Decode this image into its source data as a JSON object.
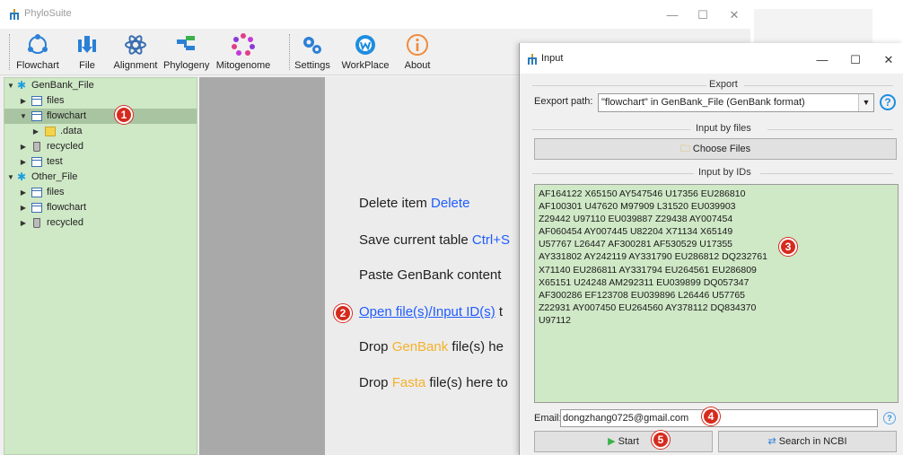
{
  "main_window": {
    "title": "PhyloSuite",
    "controls": {
      "minimize": "—",
      "maximize": "☐",
      "close": "✕"
    }
  },
  "toolbar": {
    "items": [
      {
        "label": "Flowchart",
        "icon": "flowchart-icon"
      },
      {
        "label": "File",
        "icon": "file-upload-icon"
      },
      {
        "label": "Alignment",
        "icon": "alignment-icon"
      },
      {
        "label": "Phylogeny",
        "icon": "phylogeny-icon"
      },
      {
        "label": "Mitogenome",
        "icon": "mitogenome-icon"
      },
      {
        "label": "Settings",
        "icon": "settings-icon"
      },
      {
        "label": "WorkPlace",
        "icon": "workplace-icon"
      },
      {
        "label": "About",
        "icon": "about-icon"
      }
    ]
  },
  "tree": {
    "items": [
      {
        "label": "GenBank_File",
        "level": 0,
        "expanded": true,
        "icon": "root-icon"
      },
      {
        "label": "files",
        "level": 1,
        "expanded": false,
        "icon": "table-icon"
      },
      {
        "label": "flowchart",
        "level": 1,
        "expanded": true,
        "icon": "table-icon",
        "selected": true
      },
      {
        "label": ".data",
        "level": 2,
        "expanded": false,
        "icon": "folder-icon"
      },
      {
        "label": "recycled",
        "level": 1,
        "expanded": false,
        "icon": "trash-icon"
      },
      {
        "label": "test",
        "level": 1,
        "expanded": false,
        "icon": "table-icon"
      },
      {
        "label": "Other_File",
        "level": 0,
        "expanded": true,
        "icon": "root-icon"
      },
      {
        "label": "files",
        "level": 1,
        "expanded": false,
        "icon": "table-icon"
      },
      {
        "label": "flowchart",
        "level": 1,
        "expanded": false,
        "icon": "table-icon"
      },
      {
        "label": "recycled",
        "level": 1,
        "expanded": false,
        "icon": "trash-icon"
      }
    ]
  },
  "center_hints": {
    "delete_prefix": "Delete item ",
    "delete_key": "Delete",
    "save_prefix": "Save current table ",
    "save_key": "Ctrl+S",
    "paste_text": "Paste GenBank content",
    "open_link": "Open file(s)/Input ID(s)",
    "open_suffix": " t",
    "drop_prefix": "Drop ",
    "genbank_word": "GenBank",
    "drop_genbank_suffix": " file(s) he",
    "fasta_word": "Fasta",
    "drop_fasta_suffix": " file(s) here to"
  },
  "dialog": {
    "title": "Input",
    "controls": {
      "minimize": "—",
      "maximize": "☐",
      "close": "✕"
    },
    "export_group": "Export",
    "export_path_label": "Eexport path:",
    "export_path_value": "\"flowchart\" in GenBank_File (GenBank format)",
    "files_group": "Input by files",
    "choose_files": "Choose Files",
    "ids_group": "Input by IDs",
    "ids_text": "AF164122 X65150 AY547546 U17356 EU286810\nAF100301 U47620 M97909 L31520 EU039903\nZ29442 U97110 EU039887 Z29438 AY007454\nAF060454 AY007445 U82204 X71134 X65149\nU57767 L26447 AF300281 AF530529 U17355\nAY331802 AY242119 AY331790 EU286812 DQ232761\nX71140 EU286811 AY331794 EU264561 EU286809\nX65151 U24248 AM292311 EU039899 DQ057347\nAF300286 EF123708 EU039896 L26446 U57765\nZ22931 AY007450 EU264560 AY378112 DQ834370\nU97112",
    "email_label": "Email:",
    "email_value": "dongzhang0725@gmail.com",
    "start_button": "Start",
    "search_button": "Search in NCBI",
    "help_glyph": "?"
  },
  "badges": [
    "1",
    "2",
    "3",
    "4",
    "5"
  ],
  "colors": {
    "tree_bg": "#cfe8c6",
    "tree_selected": "#a9c4a1",
    "link_blue": "#1f5cff",
    "badge_red": "#d52b1e",
    "format_orange": "#f5b12a"
  }
}
